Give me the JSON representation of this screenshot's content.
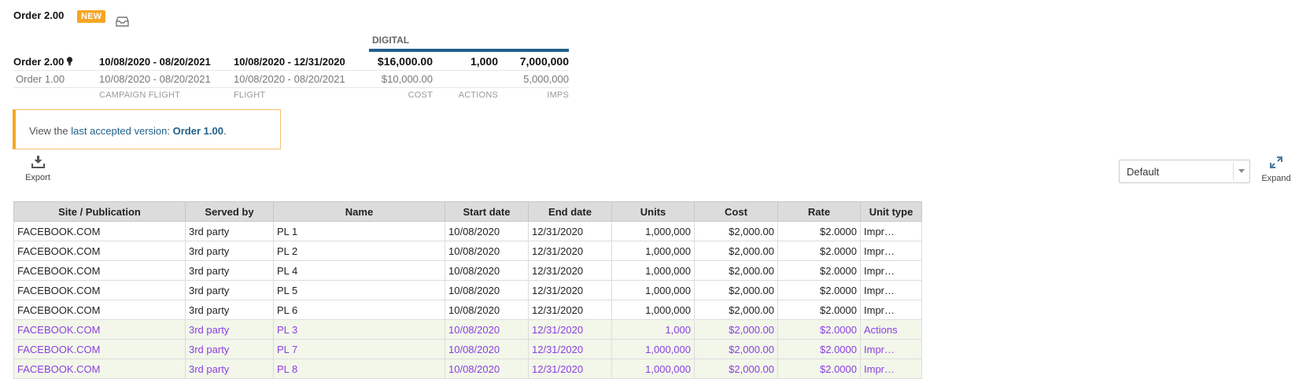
{
  "header": {
    "title": "Order 2.00",
    "badge": "NEW",
    "inbox_icon": "inbox-icon"
  },
  "summary": {
    "section_label": "DIGITAL",
    "accent_color": "#1f5f8b",
    "current": {
      "name": "Order 2.00",
      "campaign_flight": "10/08/2020 - 08/20/2021",
      "flight": "10/08/2020 - 12/31/2020",
      "cost": "$16,000.00",
      "actions": "1,000",
      "imps": "7,000,000"
    },
    "previous": {
      "name": "Order 1.00",
      "campaign_flight": "10/08/2020 - 08/20/2021",
      "flight": "10/08/2020 - 08/20/2021",
      "cost": "$10,000.00",
      "actions": "",
      "imps": "5,000,000"
    },
    "labels": {
      "campaign_flight": "CAMPAIGN FLIGHT",
      "flight": "FLIGHT",
      "cost": "COST",
      "actions": "ACTIONS",
      "imps": "IMPS"
    }
  },
  "notice": {
    "prefix": "View the ",
    "link_text": "last accepted version",
    "separator": ": ",
    "version": "Order 1.00",
    "suffix": "."
  },
  "toolbar": {
    "export_label": "Export",
    "view_select_value": "Default",
    "expand_label": "Expand"
  },
  "table": {
    "columns": [
      "Site / Publication",
      "Served by",
      "Name",
      "Start date",
      "End date",
      "Units",
      "Cost",
      "Rate",
      "Unit type"
    ],
    "changed_row_color": "#8a3fe0",
    "changed_row_bg": "#f2f7ea",
    "rows": [
      {
        "site": "FACEBOOK.COM",
        "served_by": "3rd party",
        "name": "PL 1",
        "start": "10/08/2020",
        "end": "12/31/2020",
        "units": "1,000,000",
        "cost": "$2,000.00",
        "rate": "$2.0000",
        "unit_type": "Impr…",
        "changed": false
      },
      {
        "site": "FACEBOOK.COM",
        "served_by": "3rd party",
        "name": "PL 2",
        "start": "10/08/2020",
        "end": "12/31/2020",
        "units": "1,000,000",
        "cost": "$2,000.00",
        "rate": "$2.0000",
        "unit_type": "Impr…",
        "changed": false
      },
      {
        "site": "FACEBOOK.COM",
        "served_by": "3rd party",
        "name": "PL 4",
        "start": "10/08/2020",
        "end": "12/31/2020",
        "units": "1,000,000",
        "cost": "$2,000.00",
        "rate": "$2.0000",
        "unit_type": "Impr…",
        "changed": false
      },
      {
        "site": "FACEBOOK.COM",
        "served_by": "3rd party",
        "name": "PL 5",
        "start": "10/08/2020",
        "end": "12/31/2020",
        "units": "1,000,000",
        "cost": "$2,000.00",
        "rate": "$2.0000",
        "unit_type": "Impr…",
        "changed": false
      },
      {
        "site": "FACEBOOK.COM",
        "served_by": "3rd party",
        "name": "PL 6",
        "start": "10/08/2020",
        "end": "12/31/2020",
        "units": "1,000,000",
        "cost": "$2,000.00",
        "rate": "$2.0000",
        "unit_type": "Impr…",
        "changed": false
      },
      {
        "site": "FACEBOOK.COM",
        "served_by": "3rd party",
        "name": "PL 3",
        "start": "10/08/2020",
        "end": "12/31/2020",
        "units": "1,000",
        "cost": "$2,000.00",
        "rate": "$2.0000",
        "unit_type": "Actions",
        "changed": true
      },
      {
        "site": "FACEBOOK.COM",
        "served_by": "3rd party",
        "name": "PL 7",
        "start": "10/08/2020",
        "end": "12/31/2020",
        "units": "1,000,000",
        "cost": "$2,000.00",
        "rate": "$2.0000",
        "unit_type": "Impr…",
        "changed": true
      },
      {
        "site": "FACEBOOK.COM",
        "served_by": "3rd party",
        "name": "PL 8",
        "start": "10/08/2020",
        "end": "12/31/2020",
        "units": "1,000,000",
        "cost": "$2,000.00",
        "rate": "$2.0000",
        "unit_type": "Impr…",
        "changed": true
      }
    ]
  }
}
